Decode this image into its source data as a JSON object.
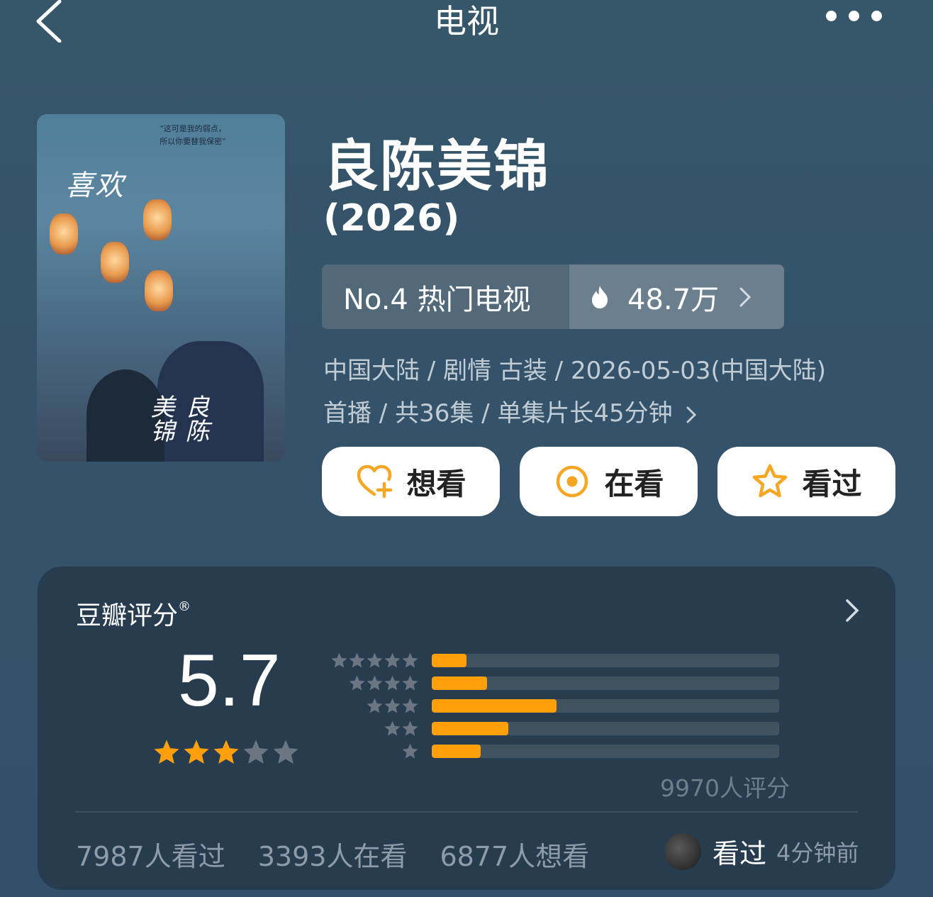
{
  "header": {
    "title": "电视",
    "back_icon": "chevron-left-icon",
    "more_icon": "more-dots-icon"
  },
  "poster": {
    "tagline_line1": "“这可是我的弱点，",
    "tagline_line2": "所以你要替我保密”",
    "headline": "喜欢",
    "calligraphy": "良陈美锦"
  },
  "show": {
    "title": "良陈美锦",
    "year": "(2026)"
  },
  "rank": {
    "label": "No.4 热门电视",
    "heat": "48.7万",
    "flame_icon": "flame-icon"
  },
  "meta": {
    "line1": "中国大陆 / 剧情 古装 / 2026-05-03(中国大陆)",
    "line2": "首播 / 共36集 / 单集片长45分钟"
  },
  "actions": {
    "want": "想看",
    "doing": "在看",
    "done": "看过"
  },
  "rating": {
    "title": "豆瓣评分",
    "registered_mark": "®",
    "score": "5.7",
    "stars_filled": 3,
    "stars_total": 5,
    "distribution": [
      {
        "stars": 5,
        "fraction": 0.1
      },
      {
        "stars": 4,
        "fraction": 0.16
      },
      {
        "stars": 3,
        "fraction": 0.36
      },
      {
        "stars": 2,
        "fraction": 0.22
      },
      {
        "stars": 1,
        "fraction": 0.14
      }
    ],
    "total_raters": "9970人评分"
  },
  "stats": {
    "watched": "7987人看过",
    "watching": "3393人在看",
    "want": "6877人想看"
  },
  "activity": {
    "label": "看过",
    "time": "4分钟前"
  },
  "colors": {
    "accent": "#ff9f0a",
    "star_gray": "#6b7682",
    "background": "#36566a",
    "card": "#283c4f"
  }
}
